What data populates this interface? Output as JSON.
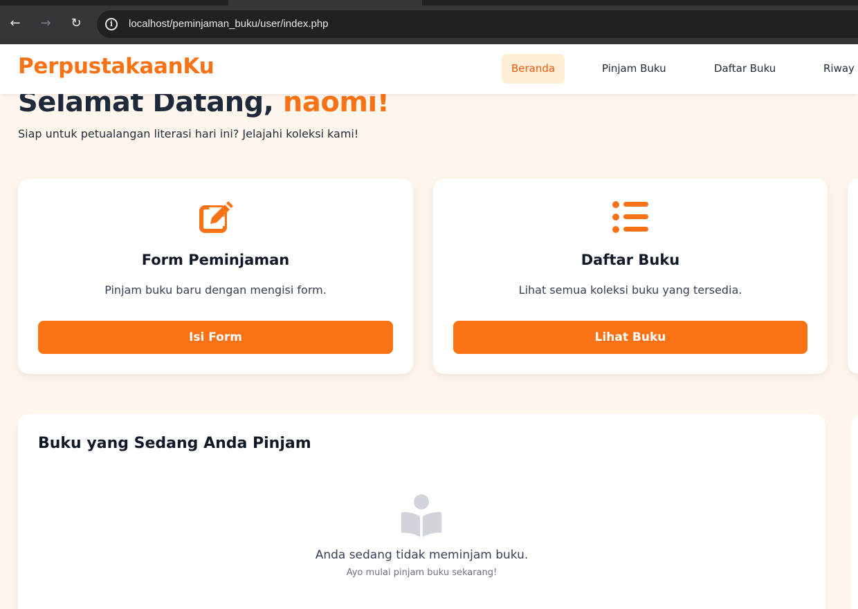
{
  "browser": {
    "url": "localhost/peminjaman_buku/user/index.php",
    "back_icon": "arrow-left-icon",
    "forward_icon": "arrow-right-icon",
    "reload_icon": "reload-icon",
    "site_info_icon": "info-icon"
  },
  "navbar": {
    "brand": "PerpustakaanKu",
    "links": [
      {
        "label": "Beranda",
        "active": true
      },
      {
        "label": "Pinjam Buku",
        "active": false
      },
      {
        "label": "Daftar Buku",
        "active": false
      },
      {
        "label": "Riway",
        "active": false
      }
    ]
  },
  "welcome": {
    "greeting": "Selamat Datang, ",
    "name": "naomi!",
    "subtitle": "Siap untuk petualangan literasi hari ini? Jelajahi koleksi kami!"
  },
  "cards": [
    {
      "icon": "edit-icon",
      "title": "Form Peminjaman",
      "description": "Pinjam buku baru dengan mengisi form.",
      "button": "Isi Form"
    },
    {
      "icon": "list-icon",
      "title": "Daftar Buku",
      "description": "Lihat semua koleksi buku yang tersedia.",
      "button": "Lihat Buku"
    }
  ],
  "borrowed": {
    "title": "Buku yang Sedang Anda Pinjam",
    "empty_icon": "reader-icon",
    "empty_text": "Anda sedang tidak meminjam buku.",
    "empty_sub": "Ayo mulai pinjam buku sekarang!"
  },
  "colors": {
    "accent": "#f97316",
    "background": "#fff7ee",
    "active_nav_bg": "#ffedd5"
  }
}
